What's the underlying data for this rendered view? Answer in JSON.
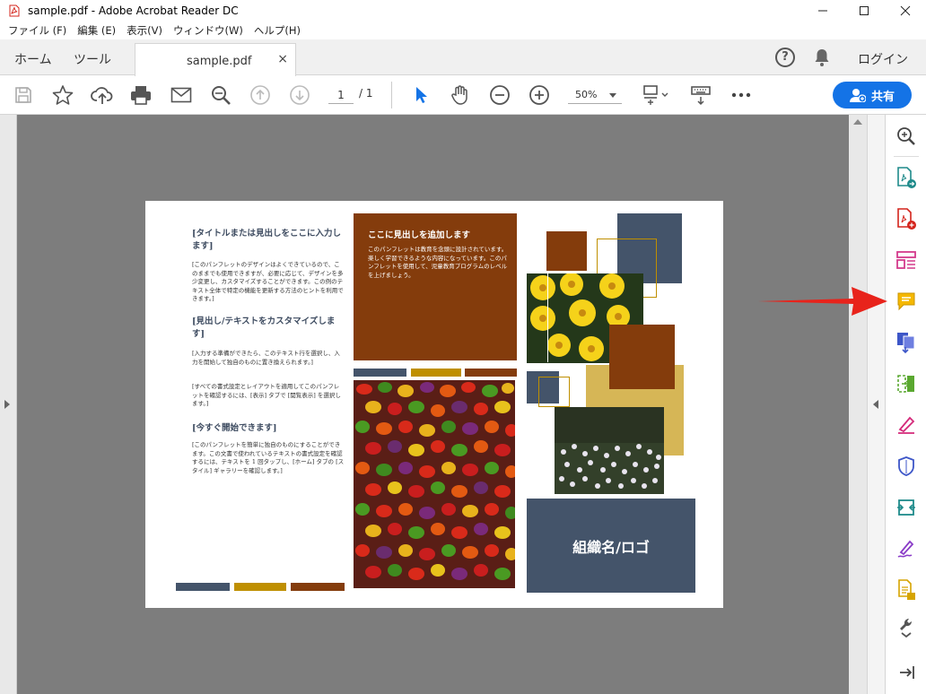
{
  "window": {
    "title": "sample.pdf - Adobe Acrobat Reader DC",
    "controls": {
      "minimize": "—",
      "maximize": "☐",
      "close": "✕"
    }
  },
  "menu": [
    "ファイル (F)",
    "編集 (E)",
    "表示(V)",
    "ウィンドウ(W)",
    "ヘルプ(H)"
  ],
  "tabs": {
    "home": "ホーム",
    "tools": "ツール",
    "document": "sample.pdf",
    "close": "×",
    "help": "?",
    "login": "ログイン"
  },
  "toolbar": {
    "page_current": "1",
    "page_sep": "/ 1",
    "zoom": "50%",
    "share_label": "共有"
  },
  "document": {
    "left_col": {
      "heading1": "[タイトルまたは見出しをここに入力します]",
      "body1": "[このパンフレットのデザインはよくできているので、このままでも使用できますが、必要に応じて、デザインを多少変更し、カスタマイズすることができます。この例のテキスト全体で特定の機能を更新する方法のヒントを利用できます。]",
      "heading2": "[見出し/テキストをカスタマイズします]",
      "body2": "[入力する準備ができたら、このテキスト行を選択し、入力を開始して独自のものに置き換えられます。]",
      "body3": "[すべての書式設定とレイアウトを適用してこのパンフレットを確認するには、[表示] タブで [閲覧表示] を選択します。]",
      "heading3": "[今すぐ開始できます]",
      "body4": "[このパンフレットを簡単に独自のものにすることができます。この文書で使われているテキストの書式設定を確認するには、テキストを 1 回タップし、[ホーム] タブの [スタイル] ギャラリーを確認します。]"
    },
    "middle_col": {
      "heading": "ここに見出しを追加します",
      "body": "このパンフレットは教育を念頭に設計されています。楽しく学習できるような内容になっています。このパンフレットを使用して、児童教育プログラムのレベルを上げましょう。"
    },
    "logo_text": "組織名/ロゴ"
  },
  "colors": {
    "accent_blue": "#1473e6",
    "slate": "#44546a",
    "gold": "#bf8f00",
    "brown": "#843c0c",
    "light_gold": "#d6b656",
    "canvas_gray": "#7d7d7d",
    "arrow_red": "#e8231b"
  },
  "icons": {
    "save": "save-icon",
    "bookmark": "star-icon",
    "upload": "cloud-upload-icon",
    "print": "printer-icon",
    "email": "envelope-icon",
    "search": "magnifier-icon",
    "prev": "arrow-up-circle-icon",
    "next": "arrow-down-circle-icon",
    "select": "cursor-icon",
    "hand": "hand-icon",
    "zoom_out": "minus-circle-icon",
    "zoom_in": "plus-circle-icon"
  }
}
